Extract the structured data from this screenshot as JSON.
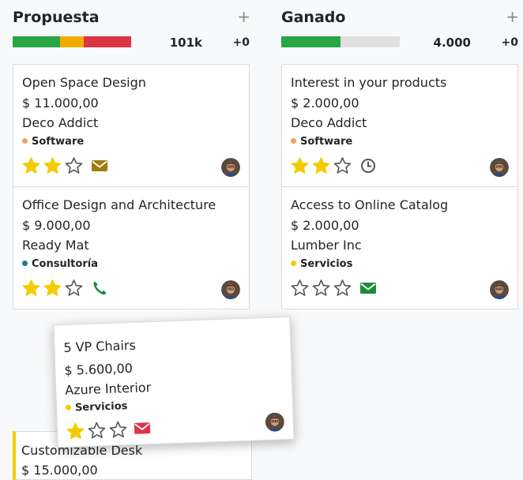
{
  "columns": [
    {
      "title": "Propuesta",
      "add_label": "+",
      "sum": "101k",
      "delta": "+0",
      "progress": [
        {
          "status": "green",
          "fraction": 0.4,
          "color": "#28a745"
        },
        {
          "status": "orange",
          "fraction": 0.2,
          "color": "#f0ad00"
        },
        {
          "status": "red",
          "fraction": 0.4,
          "color": "#dc3545"
        }
      ],
      "cards": [
        {
          "title": "Open Space Design",
          "amount": "$ 11.000,00",
          "partner": "Deco Addict",
          "tag": "Software",
          "tag_color": "#f0a35e",
          "stars": 2,
          "activity": "envelope-icon",
          "activity_color": "#a07d10"
        },
        {
          "title": "Office Design and Architecture",
          "amount": "$ 9.000,00",
          "partner": "Ready Mat",
          "tag": "Consultoría",
          "tag_color": "#1e7f86",
          "stars": 2,
          "activity": "phone-icon",
          "activity_color": "#1c8a3a"
        }
      ],
      "partial_card": {
        "title": "Customizable Desk",
        "amount": "$ 15.000,00",
        "accent": "#f3cc00"
      }
    },
    {
      "title": "Ganado",
      "add_label": "+",
      "sum": "4.000",
      "delta": "+0",
      "progress": [
        {
          "status": "green",
          "fraction": 0.5,
          "color": "#28a745"
        }
      ],
      "cards": [
        {
          "title": "Interest in your products",
          "amount": "$ 2.000,00",
          "partner": "Deco Addict",
          "tag": "Software",
          "tag_color": "#f0a35e",
          "stars": 2,
          "activity": "clock-icon",
          "activity_color": "#555555"
        },
        {
          "title": "Access to Online Catalog",
          "amount": "$ 2.000,00",
          "partner": "Lumber Inc",
          "tag": "Servicios",
          "tag_color": "#f3cc00",
          "stars": 0,
          "activity": "envelope-icon",
          "activity_color": "#1c8a3a"
        }
      ]
    }
  ],
  "dragged_card": {
    "title": "5 VP Chairs",
    "amount": "$ 5.600,00",
    "partner": "Azure Interior",
    "tag": "Servicios",
    "tag_color": "#f3cc00",
    "stars": 1,
    "activity": "envelope-icon",
    "activity_color": "#dc3545"
  },
  "colors": {
    "star_filled": "#f3cc00",
    "star_empty": "#555555",
    "background": "#f8f9fa"
  }
}
